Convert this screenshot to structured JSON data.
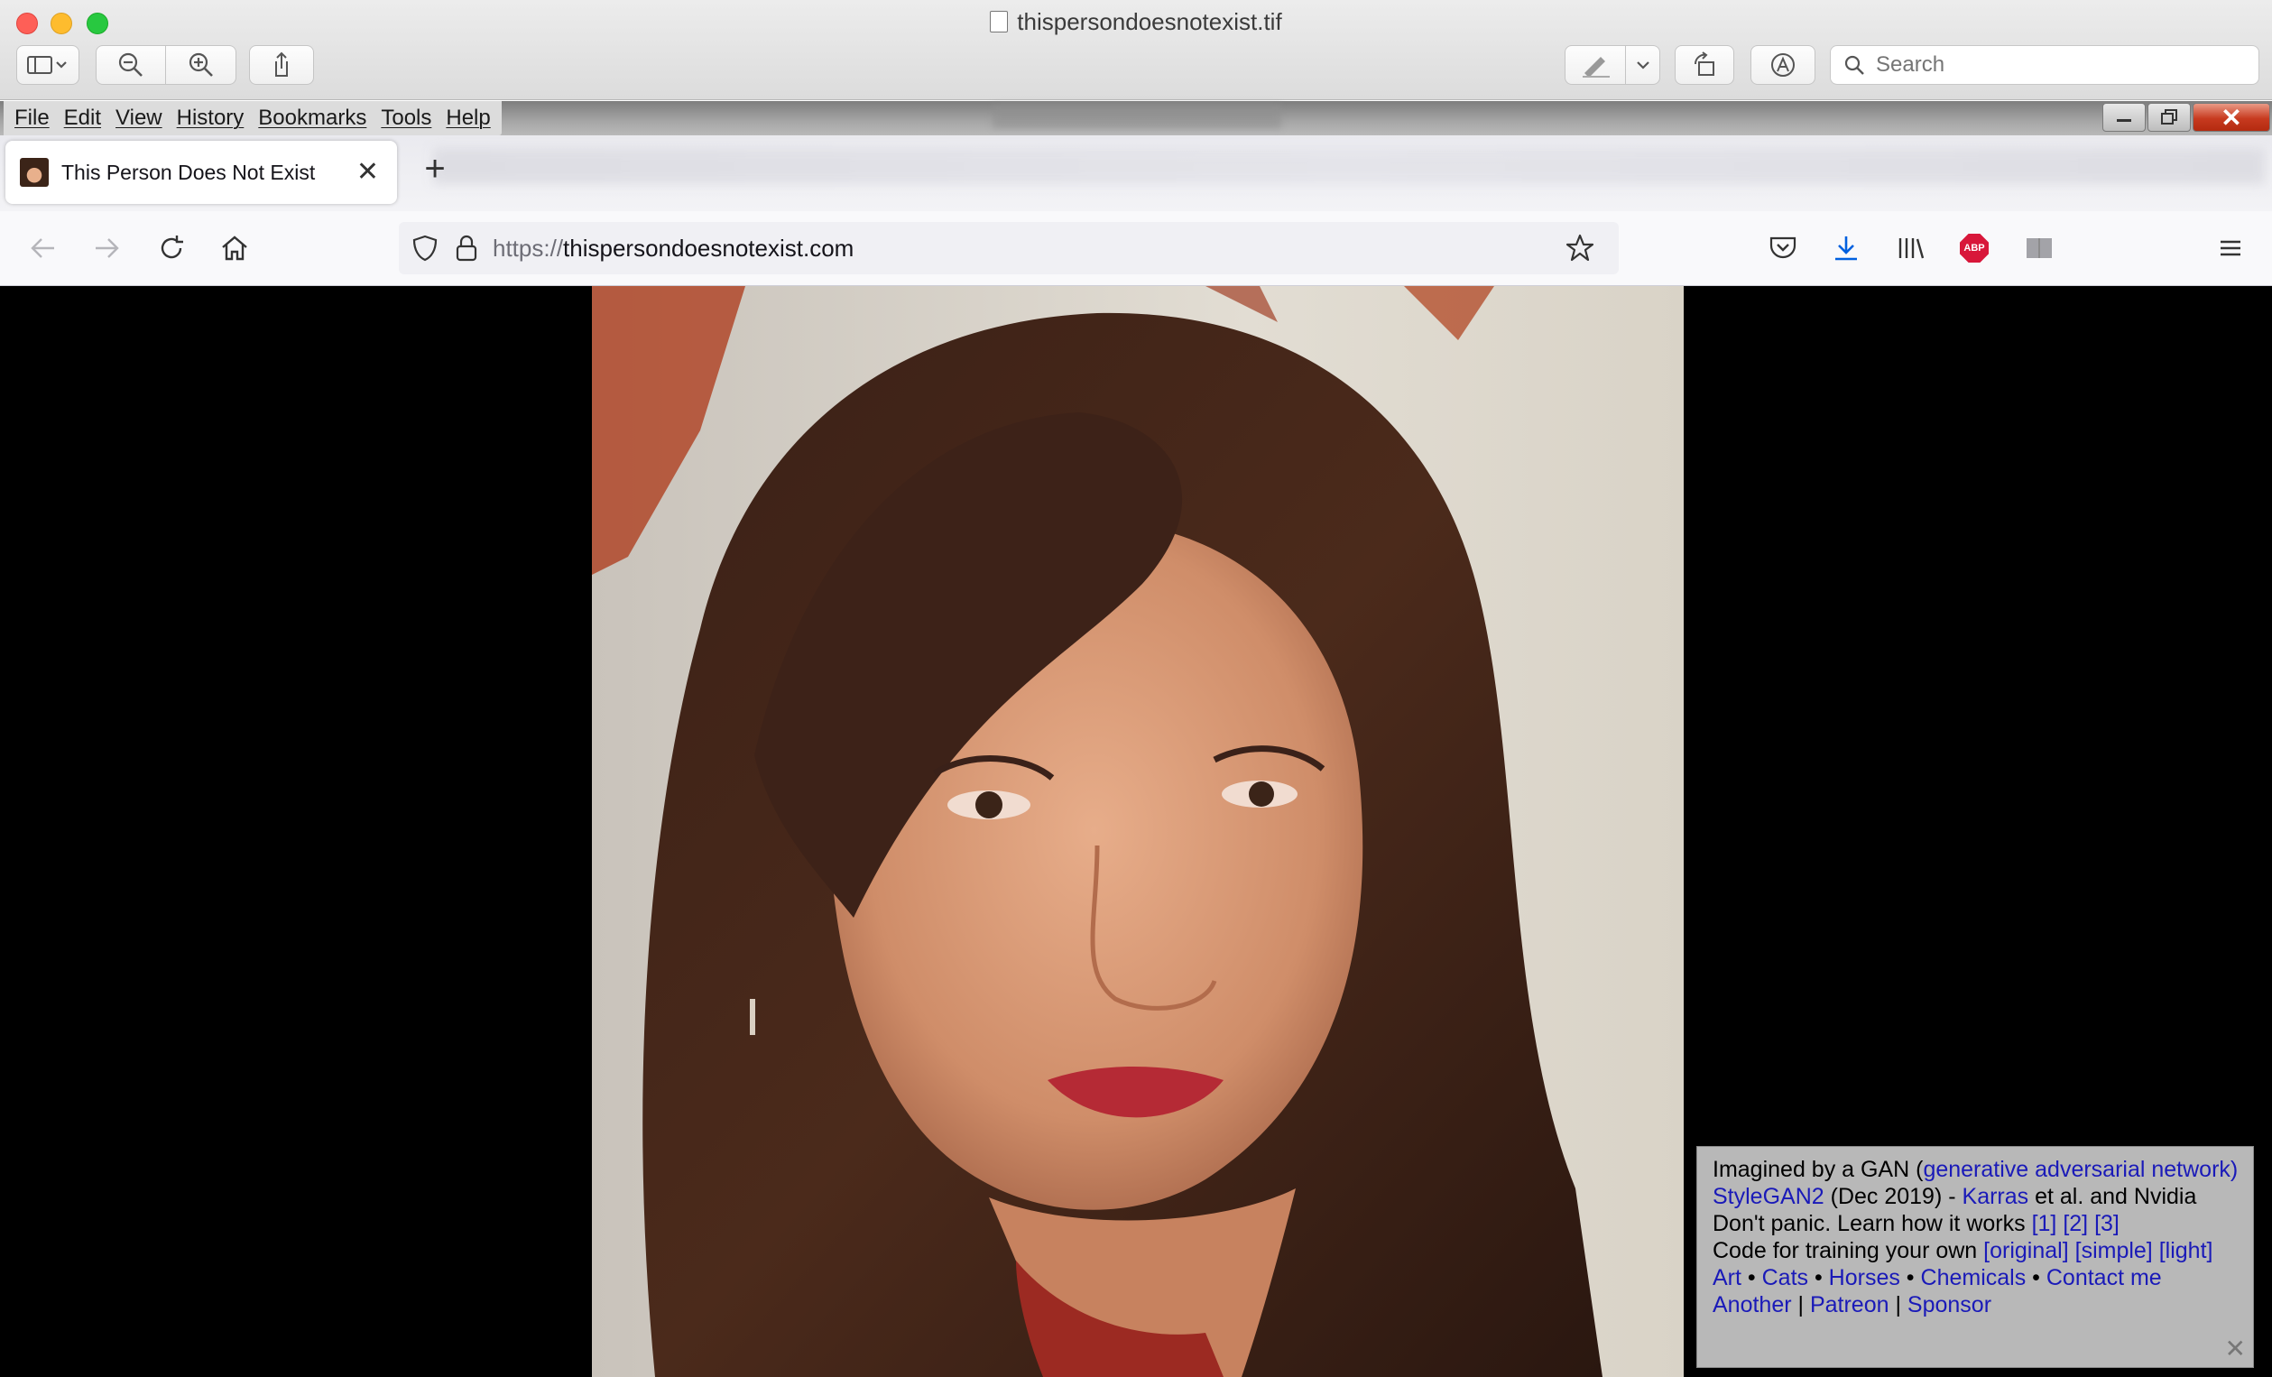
{
  "preview": {
    "window_title": "thispersondoesnotexist.tif",
    "search_placeholder": "Search",
    "colors": {
      "close": "#fe5f57",
      "minimize": "#febc2e",
      "zoom": "#28c840"
    },
    "toolbar_icons": [
      "sidebar-icon",
      "zoom-out-icon",
      "zoom-in-icon",
      "share-icon",
      "markup-pen-icon",
      "rotate-icon",
      "annotate-icon",
      "search-icon"
    ]
  },
  "firefox": {
    "menu": [
      "File",
      "Edit",
      "View",
      "History",
      "Bookmarks",
      "Tools",
      "Help"
    ],
    "window_controls": {
      "close_glyph": "✕"
    },
    "tab": {
      "title": "This Person Does Not Exist",
      "close_glyph": "✕"
    },
    "new_tab_glyph": "+",
    "url": {
      "scheme": "https://",
      "host": "thispersondoesnotexist.com"
    },
    "toolbar_icons": [
      "pocket-icon",
      "download-icon",
      "library-icon",
      "adblock-plus-icon",
      "reader-icon",
      "hamburger-menu-icon"
    ],
    "abp_label": "ABP",
    "colors": {
      "download": "#0060df",
      "abp": "#d8173a"
    }
  },
  "gan_info": {
    "line1": {
      "text": "Imagined by a GAN (",
      "link": "generative adversarial network",
      "close": ")"
    },
    "line2": {
      "link1": "StyleGAN2",
      "text1": " (Dec 2019) - ",
      "link2": "Karras",
      "text2": " et al. and Nvidia"
    },
    "line3": {
      "text": "Don't panic. Learn how it works ",
      "links": [
        "[1]",
        "[2]",
        "[3]"
      ]
    },
    "line4": {
      "text": "Code for training your own ",
      "links": [
        "[original]",
        "[simple]",
        "[light]"
      ]
    },
    "line5": {
      "links": [
        "Art",
        "Cats",
        "Horses",
        "Chemicals",
        "Contact me"
      ],
      "sep": " • "
    },
    "line6": {
      "links": [
        "Another",
        "Patreon",
        "Sponsor"
      ],
      "sep": " | "
    },
    "close_glyph": "✕"
  }
}
